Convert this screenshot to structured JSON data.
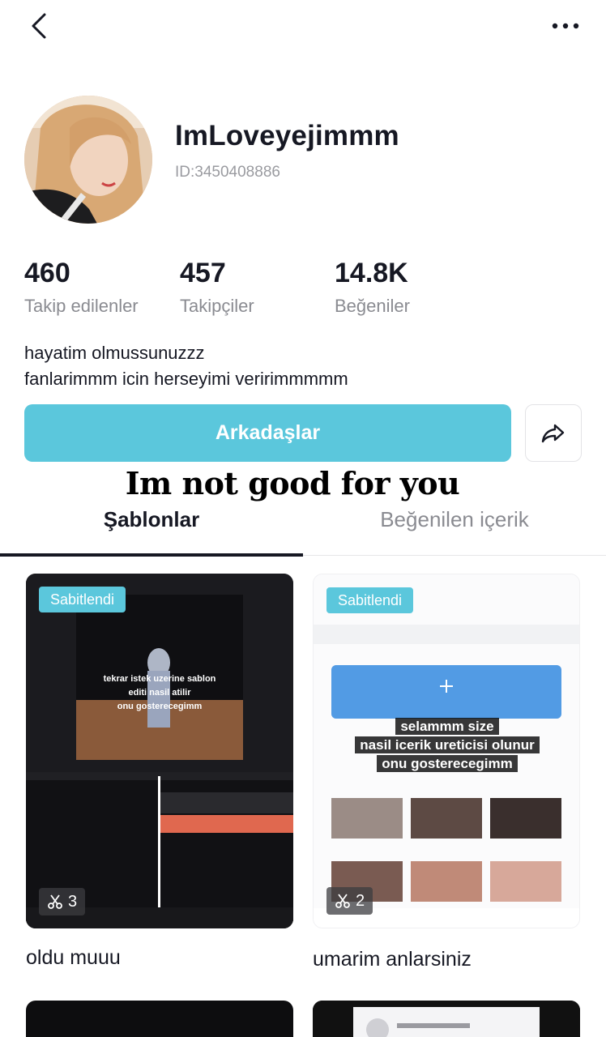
{
  "profile": {
    "username": "ImLoveyejimmm",
    "id": "ID:3450408886",
    "bio_line1": "hayatim olmussunuzzz",
    "bio_line2": "fanlarimmm icin herseyimi veririmmmmm"
  },
  "stats": {
    "following_count": "460",
    "following_label": "Takip edilenler",
    "followers_count": "457",
    "followers_label": "Takipçiler",
    "likes_count": "14.8K",
    "likes_label": "Beğeniler"
  },
  "actions": {
    "friends_label": "Arkadaşlar"
  },
  "overlay_text": "Im not good for you",
  "tabs": {
    "templates": "Şablonlar",
    "liked": "Beğenilen içerik"
  },
  "cards": [
    {
      "badge": "Sabitlendi",
      "clips": "3",
      "title": "oldu muuu",
      "caption_line1": "tekrar istek uzerine sablon",
      "caption_line2": "editi nasil atilir",
      "caption_line3": "onu gosterecegimm"
    },
    {
      "badge": "Sabitlendi",
      "clips": "2",
      "title": "umarim anlarsiniz",
      "caption_line1": "selammm size",
      "caption_line2": "nasil icerik ureticisi olunur",
      "caption_line3": "onu gosterecegimm"
    }
  ],
  "colors": {
    "accent": "#5bc7dc",
    "text_primary": "#161823",
    "text_secondary": "#8a8b91"
  },
  "icons": {
    "back": "chevron-left-icon",
    "more": "more-horizontal-icon",
    "share": "share-arrow-icon",
    "clips": "scissors-icon"
  }
}
